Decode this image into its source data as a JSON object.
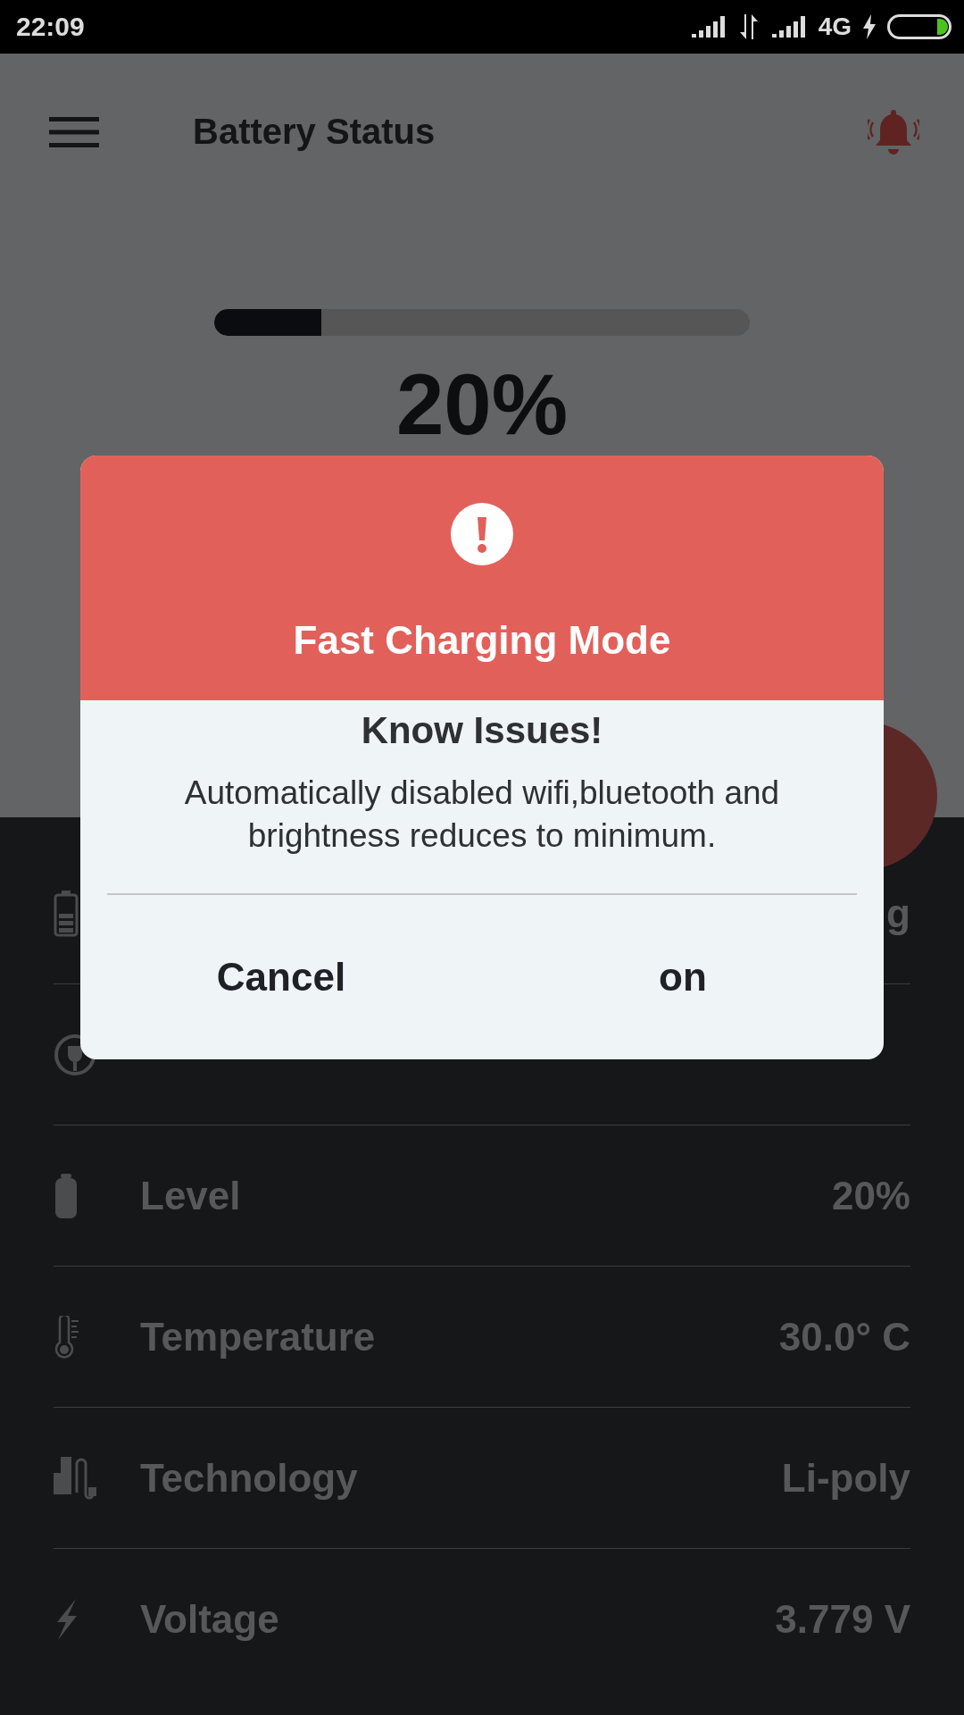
{
  "status_bar": {
    "time": "22:09",
    "network": "4G"
  },
  "app_bar": {
    "title": "Battery Status"
  },
  "battery": {
    "level": 0.2,
    "percent": "20%"
  },
  "details": [
    {
      "kind": "status",
      "value": "g"
    },
    {
      "kind": "plugged"
    },
    {
      "kind": "level",
      "label": "Level",
      "value": "20%"
    },
    {
      "kind": "temperature",
      "label": "Temperature",
      "value": "30.0° C"
    },
    {
      "kind": "technology",
      "label": "Technology",
      "value": "Li-poly"
    },
    {
      "kind": "voltage",
      "label": "Voltage",
      "value": "3.779 V"
    }
  ],
  "dialog": {
    "title": "Fast Charging Mode",
    "heading": "Know Issues!",
    "message": "Automatically disabled wifi,bluetooth and brightness reduces to minimum.",
    "buttons": [
      {
        "label": "Cancel"
      },
      {
        "label": "on"
      }
    ]
  }
}
